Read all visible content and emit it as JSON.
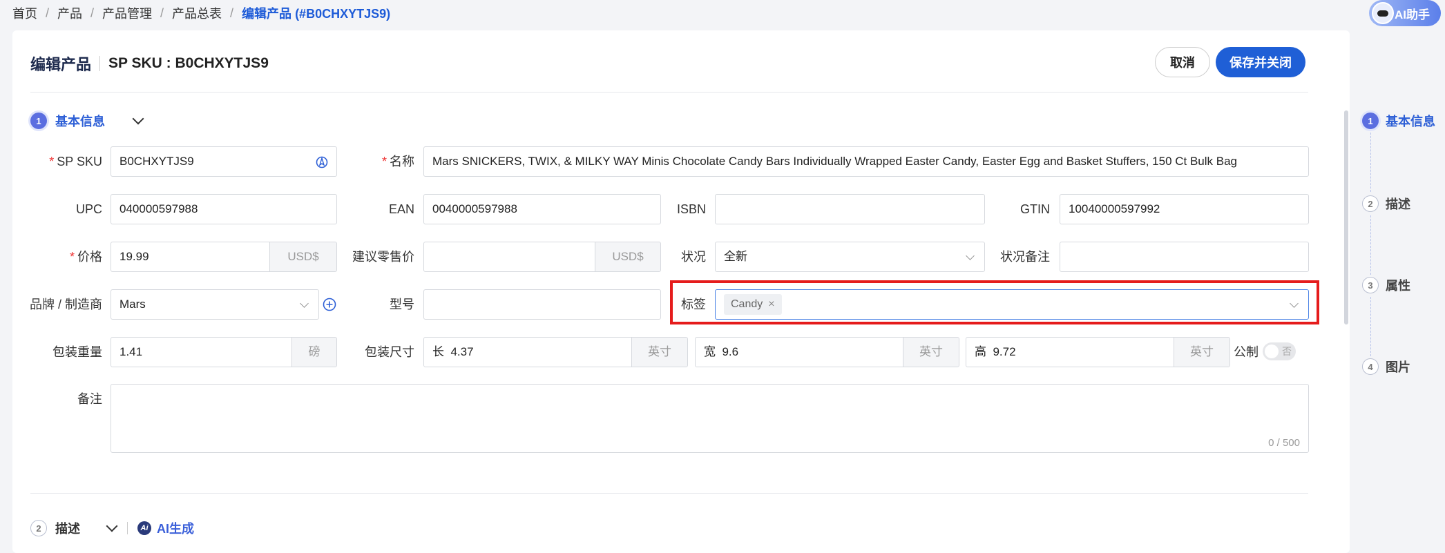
{
  "breadcrumb": [
    "首页",
    "产品",
    "产品管理",
    "产品总表"
  ],
  "breadcrumb_current": "编辑产品 (#B0CHXYTJS9)",
  "ai_assistant": "AI助手",
  "header": {
    "title": "编辑产品",
    "sku": "SP SKU : B0CHXYTJS9",
    "cancel": "取消",
    "save": "保存并关闭"
  },
  "section1": {
    "num": "1",
    "title": "基本信息"
  },
  "section2": {
    "num": "2",
    "title": "描述",
    "ai_gen": "AI生成"
  },
  "form": {
    "sp_sku": {
      "label": "SP SKU",
      "value": "B0CHXYTJS9"
    },
    "name": {
      "label": "名称",
      "value": "Mars SNICKERS, TWIX, & MILKY WAY Minis Chocolate Candy Bars Individually Wrapped Easter Candy, Easter Egg and Basket Stuffers, 150 Ct Bulk Bag"
    },
    "upc": {
      "label": "UPC",
      "value": "040000597988"
    },
    "ean": {
      "label": "EAN",
      "value": "0040000597988"
    },
    "isbn": {
      "label": "ISBN",
      "value": ""
    },
    "gtin": {
      "label": "GTIN",
      "value": "10040000597992"
    },
    "price": {
      "label": "价格",
      "value": "19.99",
      "unit": "USD$"
    },
    "msrp": {
      "label": "建议零售价",
      "value": "",
      "unit": "USD$"
    },
    "condition": {
      "label": "状况",
      "value": "全新"
    },
    "condition_note": {
      "label": "状况备注",
      "value": ""
    },
    "brand": {
      "label_a": "品牌",
      "label_sep": "/",
      "label_b": "制造商",
      "value": "Mars"
    },
    "model": {
      "label": "型号",
      "value": ""
    },
    "tags": {
      "label": "标签",
      "items": [
        "Candy"
      ]
    },
    "weight": {
      "label": "包装重量",
      "value": "1.41",
      "unit": "磅"
    },
    "dims": {
      "label": "包装尺寸",
      "length_label": "长",
      "length": "4.37",
      "width_label": "宽",
      "width": "9.6",
      "height_label": "高",
      "height": "9.72",
      "unit": "英寸",
      "metric_label": "公制",
      "metric_toggle": "否"
    },
    "notes": {
      "label": "备注",
      "value": "",
      "counter": "0 / 500"
    }
  },
  "nav": [
    {
      "num": "1",
      "label": "基本信息"
    },
    {
      "num": "2",
      "label": "描述"
    },
    {
      "num": "3",
      "label": "属性"
    },
    {
      "num": "4",
      "label": "图片"
    }
  ],
  "colors": {
    "accent": "#1f5fd6",
    "highlight": "#e51c1c"
  }
}
